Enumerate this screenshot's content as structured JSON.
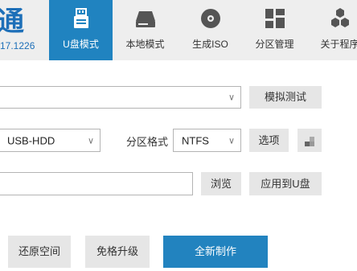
{
  "logo": {
    "char": "通",
    "version": "17.1226"
  },
  "tabs": [
    {
      "label": "U盘模式",
      "icon": "usb-drive-icon",
      "active": true
    },
    {
      "label": "本地模式",
      "icon": "hard-disk-icon",
      "active": false
    },
    {
      "label": "生成ISO",
      "icon": "disc-icon",
      "active": false
    },
    {
      "label": "分区管理",
      "icon": "partition-grid-icon",
      "active": false
    },
    {
      "label": "关于程序",
      "icon": "about-hexagons-icon",
      "active": false
    }
  ],
  "device_select": {
    "value": "",
    "caret": "∨"
  },
  "simulate_button": "模拟测试",
  "mode_select": {
    "value": "USB-HDD",
    "caret": "∨"
  },
  "partition_format_label": "分区格式",
  "format_select": {
    "value": "NTFS",
    "caret": "∨"
  },
  "options_button": "选项",
  "path_input": {
    "value": ""
  },
  "browse_button": "浏览",
  "apply_button": "应用到U盘",
  "restore_space_button": "还原空间",
  "format_free_upgrade_button": "免格升级",
  "new_build_button": "全新制作",
  "colors": {
    "accent": "#2083c0",
    "tabbar": "#eeeeee",
    "button": "#e6e6e6"
  }
}
